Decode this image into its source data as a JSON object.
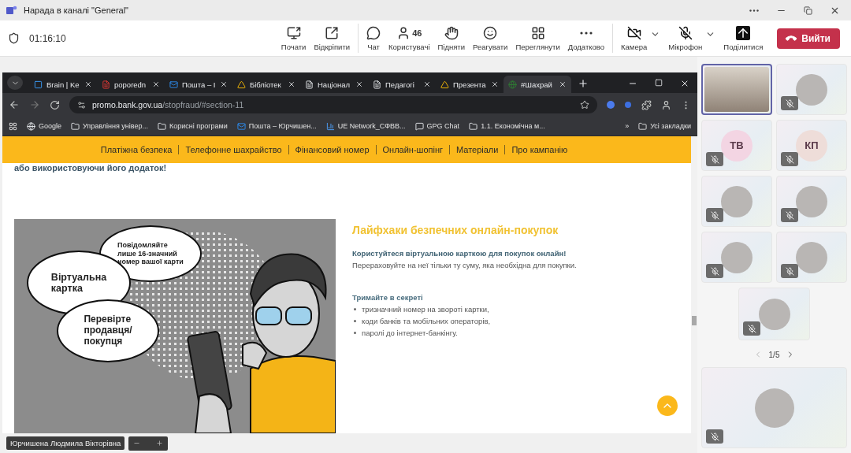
{
  "window": {
    "title": "Нарада в каналі \"General\""
  },
  "meeting_bar": {
    "timer": "01:16:10",
    "tool_groups": [
      {
        "tools": [
          {
            "kind": "share",
            "label": "Почати"
          },
          {
            "kind": "popout",
            "label": "Відкріпити"
          }
        ]
      },
      {
        "tools": [
          {
            "kind": "chat",
            "label": "Чат"
          },
          {
            "kind": "people",
            "label": "Користувачі",
            "count": "46"
          },
          {
            "kind": "hand",
            "label": "Підняти"
          },
          {
            "kind": "react",
            "label": "Реагувати"
          },
          {
            "kind": "view",
            "label": "Переглянути"
          },
          {
            "kind": "more",
            "label": "Додатково"
          }
        ]
      },
      {
        "tools": [
          {
            "kind": "camera",
            "label": "Камера",
            "off": true,
            "has_menu": true
          },
          {
            "kind": "mic",
            "label": "Мікрофон",
            "off": true,
            "has_menu": true
          },
          {
            "kind": "present",
            "label": "Поділитися"
          }
        ]
      }
    ],
    "leave": "Вийти"
  },
  "browser": {
    "tabs": [
      {
        "kind": "brain",
        "label": "Brain | Ke",
        "selected": false
      },
      {
        "kind": "pdf",
        "label": "poporedn",
        "selected": false
      },
      {
        "kind": "mail",
        "label": "Пошта – І",
        "selected": false
      },
      {
        "kind": "drive",
        "label": "Бібліотек",
        "selected": false
      },
      {
        "kind": "doc",
        "label": "Націонал",
        "selected": false
      },
      {
        "kind": "doc",
        "label": "Педагогі",
        "selected": false
      },
      {
        "kind": "drive",
        "label": "Презента",
        "selected": false
      },
      {
        "kind": "site",
        "label": "#Шахрай",
        "selected": true
      }
    ],
    "url_host": "promo.bank.gov.ua",
    "url_path": "/stopfraud/#section-11",
    "bookmarks": [
      {
        "kind": "google",
        "label": "Google"
      },
      {
        "kind": "folder",
        "label": "Управління універ..."
      },
      {
        "kind": "folder",
        "label": "Корисні програми"
      },
      {
        "kind": "mail",
        "label": "Пошта – Юрчишен..."
      },
      {
        "kind": "network",
        "label": "UE Network_СФВВ..."
      },
      {
        "kind": "chat",
        "label": "GPG Chat"
      },
      {
        "kind": "folder",
        "label": "1.1. Економічна м..."
      }
    ],
    "bookmarks_more": "»",
    "all_bookmarks": "Усі закладки"
  },
  "page": {
    "nav": [
      "Платіжна безпека",
      "Телефонне шахрайство",
      "Фінансовий номер",
      "Онлайн-шопінг",
      "Матеріали",
      "Про кампанію"
    ],
    "intro_tail": "або використовуючи його додаток!",
    "bubbles": [
      "Повідомляйте\nлише 16-значний\nномер вашої карти",
      "Віртуальна\nкартка",
      "Перевірте\nпродавця/\nпокупця"
    ],
    "heading": "Лайфхаки безпечних онлайн-покупок",
    "lead": "Користуйтеся віртуальною карткою для покупок онлайн!",
    "lead_text": "Перераховуйте на неї тільки ту суму, яка необхідна для покупки.",
    "secret_title": "Тримайте в секреті",
    "secret_items": [
      "тризначний номер на звороті картки,",
      "коди банків та мобільних операторів,",
      "паролі до інтернет-банкінгу."
    ]
  },
  "presenter": "Юрчишена Людмила Вікторівна",
  "participants": {
    "tiles": [
      {
        "kind": "video",
        "speaking": true,
        "muted": false
      },
      {
        "kind": "photo",
        "speaking": false,
        "muted": true
      },
      {
        "kind": "initials",
        "initials": "ТВ",
        "color": "#f3d5e3",
        "speaking": false,
        "muted": true
      },
      {
        "kind": "initials",
        "initials": "КП",
        "color": "#eeddd9",
        "speaking": false,
        "muted": true
      },
      {
        "kind": "photo",
        "speaking": false,
        "muted": true
      },
      {
        "kind": "photo",
        "speaking": false,
        "muted": true
      },
      {
        "kind": "photo",
        "speaking": false,
        "muted": true
      },
      {
        "kind": "photo",
        "speaking": false,
        "muted": true
      },
      {
        "kind": "photo",
        "speaking": false,
        "muted": true
      }
    ],
    "pager": "1/5",
    "self_tile": {
      "kind": "photo",
      "muted": true
    }
  }
}
